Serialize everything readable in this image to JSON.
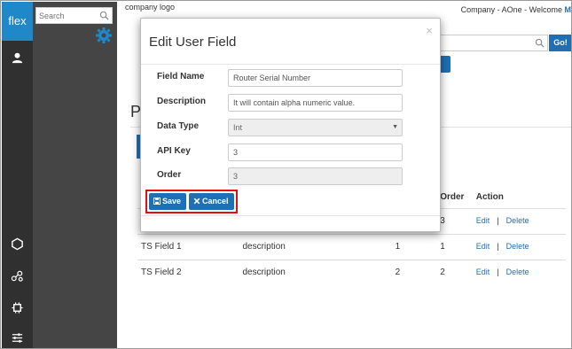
{
  "rail": {
    "logo": "flex"
  },
  "sidebar": {
    "search_placeholder": "Search"
  },
  "header": {
    "company_logo": "company logo",
    "welcome_prefix": "Company - AOne - Welcome",
    "welcome_user": "M"
  },
  "topbar": {
    "search_value": "",
    "go_label": "Go!",
    "add_label": "e"
  },
  "page": {
    "title": "P"
  },
  "table": {
    "headers": {
      "api": "",
      "order": "Order",
      "action": "Action"
    },
    "rows": [
      {
        "name": "",
        "description": "",
        "api": "",
        "order": "3",
        "edit": "Edit",
        "sep": "|",
        "delete": "Delete"
      },
      {
        "name": "TS Field 1",
        "description": "description",
        "api": "1",
        "order": "1",
        "edit": "Edit",
        "sep": "|",
        "delete": "Delete"
      },
      {
        "name": "TS Field 2",
        "description": "description",
        "api": "2",
        "order": "2",
        "edit": "Edit",
        "sep": "|",
        "delete": "Delete"
      }
    ]
  },
  "modal": {
    "title": "Edit User Field",
    "close": "×",
    "fields": {
      "field_name_label": "Field Name",
      "field_name_value": "Router Serial Number",
      "description_label": "Description",
      "description_value": "It will contain alpha numeric value.",
      "data_type_label": "Data Type",
      "data_type_value": "Int",
      "api_key_label": "API Key",
      "api_key_value": "3",
      "order_label": "Order",
      "order_value": "3"
    },
    "save_label": "Save",
    "cancel_label": "Cancel"
  },
  "colors": {
    "accent": "#1e6fb5",
    "rail_bg": "#303030",
    "sidebar_bg": "#454545",
    "highlight": "#dd1111"
  }
}
